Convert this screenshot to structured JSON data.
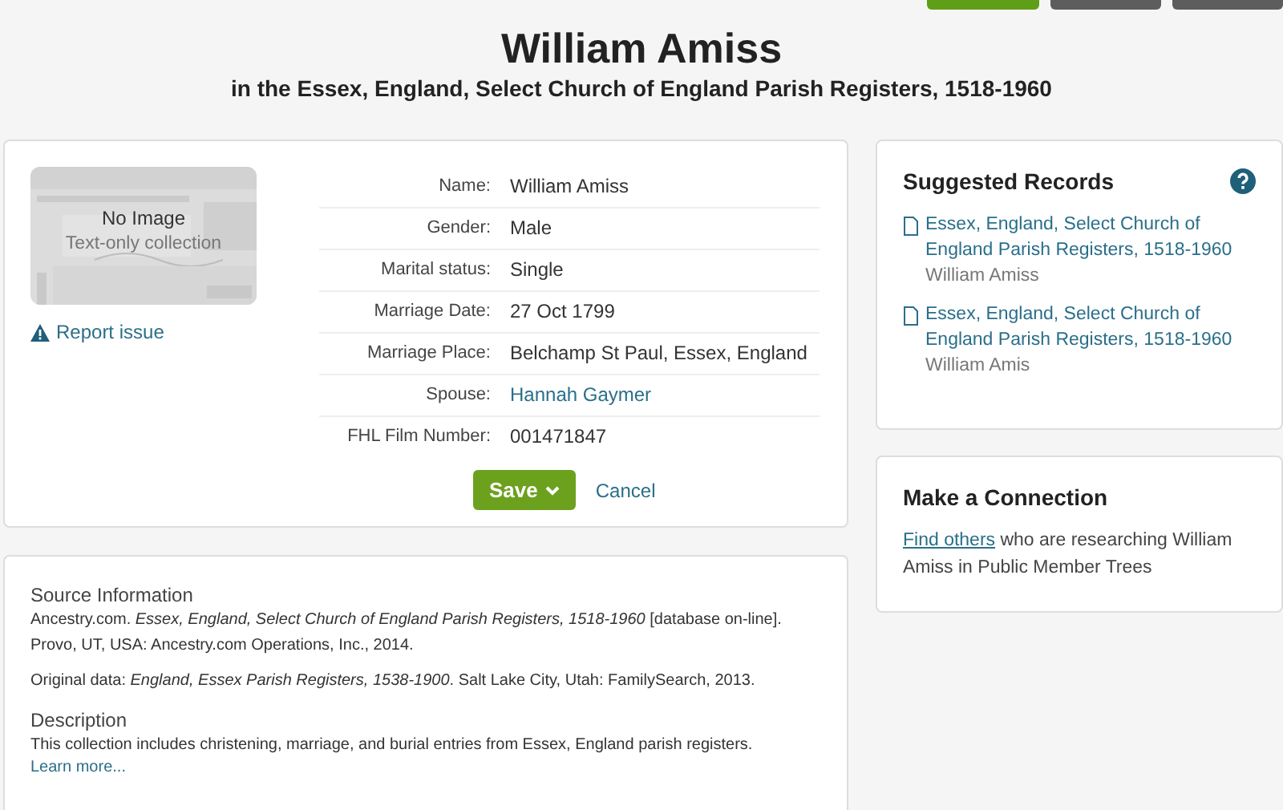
{
  "top_actions": [
    {
      "kind": "primary"
    },
    {
      "kind": "secondary"
    },
    {
      "kind": "secondary"
    }
  ],
  "header": {
    "title": "William Amiss",
    "subtitle": "in the Essex, England, Select Church of England Parish Registers, 1518-1960"
  },
  "record": {
    "image": {
      "title": "No Image",
      "caption": "Text-only collection"
    },
    "report_link": "Report issue",
    "fields": [
      {
        "label": "Name:",
        "value": "William Amiss",
        "kind": "text"
      },
      {
        "label": "Gender:",
        "value": "Male",
        "kind": "text"
      },
      {
        "label": "Marital status:",
        "value": "Single",
        "kind": "text"
      },
      {
        "label": "Marriage Date:",
        "value": "27 Oct 1799",
        "kind": "text"
      },
      {
        "label": "Marriage Place:",
        "value": "Belchamp St Paul, Essex, England",
        "kind": "text"
      },
      {
        "label": "Spouse:",
        "value": "Hannah Gaymer",
        "kind": "link"
      },
      {
        "label": "FHL Film Number:",
        "value": "001471847",
        "kind": "text"
      }
    ],
    "save_button": "Save",
    "cancel_link": "Cancel"
  },
  "source": {
    "heading": "Source Information",
    "paragraphs": [
      "Ancestry.com. *Essex, England, Select Church of England Parish Registers, 1518-1960* [database on-line]. Provo, UT, USA: Ancestry.com Operations, Inc., 2014.",
      "Original data: *England, Essex Parish Registers, 1538-1900*. Salt Lake City, Utah: FamilySearch, 2013."
    ],
    "description_heading": "Description",
    "description": "This collection includes christening, marriage, and burial entries from Essex, England parish registers.",
    "learn_more": "Learn more..."
  },
  "suggested": {
    "title": "Suggested Records",
    "items": [
      {
        "title": "Essex, England, Select Church of England Parish Registers, 1518-1960",
        "person": "William Amiss"
      },
      {
        "title": "Essex, England, Select Church of England Parish Registers, 1518-1960",
        "person": "William Amis"
      }
    ]
  },
  "connection": {
    "title": "Make a Connection",
    "link": "Find others",
    "text": " who are researching William Amiss in Public Member Trees"
  }
}
